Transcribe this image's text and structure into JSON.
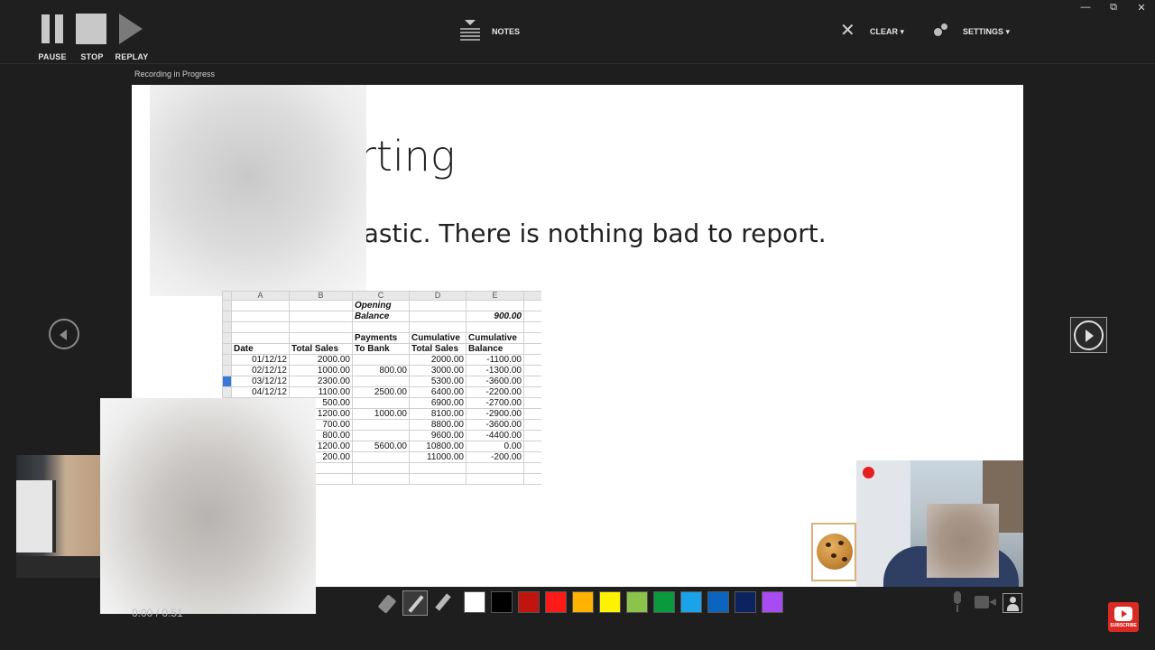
{
  "toolbar": {
    "pause_label": "PAUSE",
    "stop_label": "STOP",
    "replay_label": "REPLAY",
    "notes_label": "NOTES",
    "clear_label": "CLEAR ▾",
    "settings_label": "SETTINGS ▾"
  },
  "window_controls": {
    "minimize": "—",
    "restore": "⧉",
    "close": "✕"
  },
  "status": {
    "recording": "Recording in Progress",
    "timer": "0:00 / 0:51"
  },
  "slide": {
    "title_visible": "rting",
    "body_visible": "ntastic. There is nothing bad to report."
  },
  "spreadsheet": {
    "column_headers": [
      "A",
      "B",
      "C",
      "D",
      "E"
    ],
    "opening_label_1": "Opening",
    "opening_label_2": "Balance",
    "opening_value": "900.00",
    "headers_row1": [
      "",
      "",
      "Payments",
      "Cumulative",
      "Cumulative"
    ],
    "headers_row2": [
      "Date",
      "Total Sales",
      "To Bank",
      "Total Sales",
      "Balance"
    ],
    "rows": [
      [
        "01/12/12",
        "2000.00",
        "",
        "2000.00",
        "-1100.00"
      ],
      [
        "02/12/12",
        "1000.00",
        "800.00",
        "3000.00",
        "-1300.00"
      ],
      [
        "03/12/12",
        "2300.00",
        "",
        "5300.00",
        "-3600.00"
      ],
      [
        "04/12/12",
        "1100.00",
        "2500.00",
        "6400.00",
        "-2200.00"
      ],
      [
        "",
        "500.00",
        "",
        "6900.00",
        "-2700.00"
      ],
      [
        "",
        "1200.00",
        "1000.00",
        "8100.00",
        "-2900.00"
      ],
      [
        "",
        "700.00",
        "",
        "8800.00",
        "-3600.00"
      ],
      [
        "",
        "800.00",
        "",
        "9600.00",
        "-4400.00"
      ],
      [
        "",
        "1200.00",
        "5600.00",
        "10800.00",
        "0.00"
      ],
      [
        "",
        "200.00",
        "",
        "11000.00",
        "-200.00"
      ]
    ]
  },
  "pen_colors": [
    "#ffffff",
    "#000000",
    "#c0150f",
    "#ff1a1a",
    "#ffb300",
    "#fff200",
    "#8cc34a",
    "#0a9a3e",
    "#1aa3e8",
    "#0b64c0",
    "#0c2360",
    "#a84bf0"
  ],
  "youtube": {
    "subscribe": "SUBSCRIBE"
  },
  "colors": {
    "background": "#1e1e1e",
    "record_dot": "#e41f1f"
  }
}
